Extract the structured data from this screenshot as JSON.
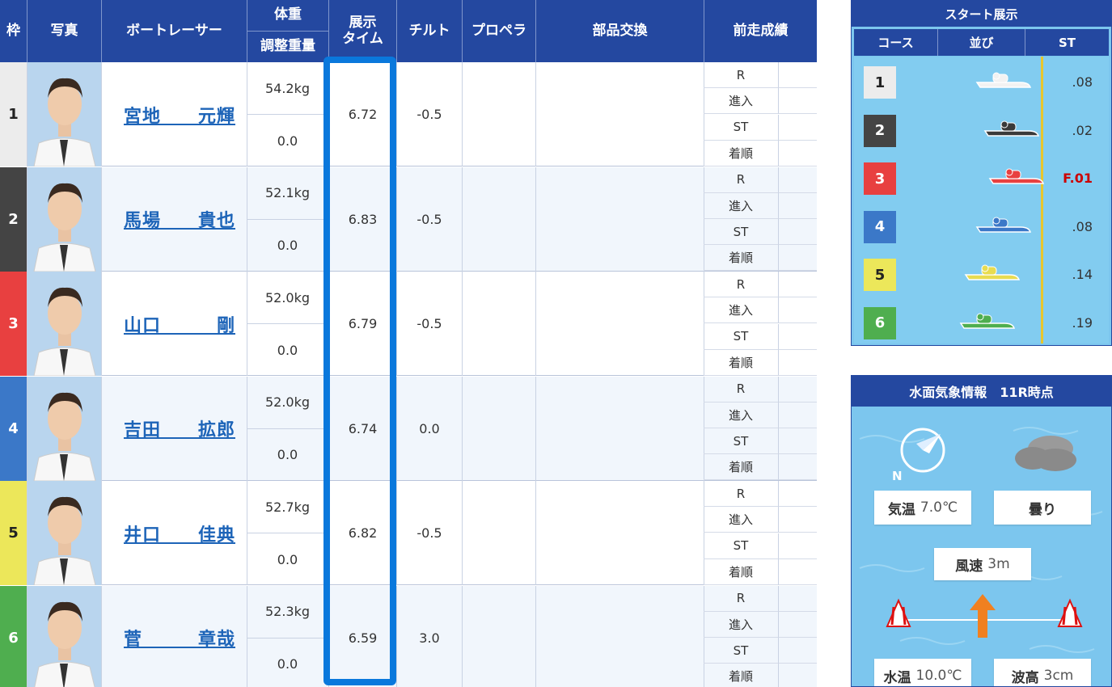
{
  "table": {
    "headers": {
      "waku": "枠",
      "photo": "写真",
      "racer": "ボートレーサー",
      "weight": "体重",
      "adjust": "調整重量",
      "exhibit": "展示\nタイム",
      "tilt": "チルト",
      "propeller": "プロペラ",
      "parts": "部品交換",
      "prev": "前走成績"
    },
    "prev_labels": [
      "R",
      "進入",
      "ST",
      "着順"
    ],
    "rows": [
      {
        "waku": "1",
        "name": "宮地　　元輝",
        "weight": "54.2kg",
        "adjust": "0.0",
        "time": "6.72",
        "tilt": "-0.5",
        "color": "#ececec",
        "text_color": "#222"
      },
      {
        "waku": "2",
        "name": "馬場　　貴也",
        "weight": "52.1kg",
        "adjust": "0.0",
        "time": "6.83",
        "tilt": "-0.5",
        "color": "#444444",
        "text_color": "#fff"
      },
      {
        "waku": "3",
        "name": "山口　　　剛",
        "weight": "52.0kg",
        "adjust": "0.0",
        "time": "6.79",
        "tilt": "-0.5",
        "color": "#e84040",
        "text_color": "#fff"
      },
      {
        "waku": "4",
        "name": "吉田　　拡郎",
        "weight": "52.0kg",
        "adjust": "0.0",
        "time": "6.74",
        "tilt": "0.0",
        "color": "#3b78c8",
        "text_color": "#fff"
      },
      {
        "waku": "5",
        "name": "井口　　佳典",
        "weight": "52.7kg",
        "adjust": "0.0",
        "time": "6.82",
        "tilt": "-0.5",
        "color": "#ece75a",
        "text_color": "#222"
      },
      {
        "waku": "6",
        "name": "菅　　　章哉",
        "weight": "52.3kg",
        "adjust": "0.0",
        "time": "6.59",
        "tilt": "3.0",
        "color": "#4fae4f",
        "text_color": "#fff"
      }
    ]
  },
  "start_display": {
    "title": "スタート展示",
    "headers": [
      "コース",
      "並び",
      "ST"
    ],
    "rows": [
      {
        "course": "1",
        "st": ".08",
        "color": "#ececec",
        "text_color": "#222",
        "boat_color": "#f2f2f2"
      },
      {
        "course": "2",
        "st": ".02",
        "color": "#444444",
        "text_color": "#fff",
        "boat_color": "#3a3a3a"
      },
      {
        "course": "3",
        "st": "F.01",
        "color": "#e84040",
        "text_color": "#fff",
        "boat_color": "#e84040"
      },
      {
        "course": "4",
        "st": ".08",
        "color": "#3b78c8",
        "text_color": "#fff",
        "boat_color": "#3b78c8"
      },
      {
        "course": "5",
        "st": ".14",
        "color": "#ece75a",
        "text_color": "#222",
        "boat_color": "#e8dc50"
      },
      {
        "course": "6",
        "st": ".19",
        "color": "#4fae4f",
        "text_color": "#fff",
        "boat_color": "#4fae4f"
      }
    ]
  },
  "weather": {
    "title": "水面気象情報　11R時点",
    "compass_label": "N",
    "temp_label": "気温",
    "temp_value": "7.0℃",
    "weather_value": "曇り",
    "wind_label": "風速",
    "wind_value": "3m",
    "water_label": "水温",
    "water_value": "10.0℃",
    "wave_label": "波高",
    "wave_value": "3cm"
  }
}
